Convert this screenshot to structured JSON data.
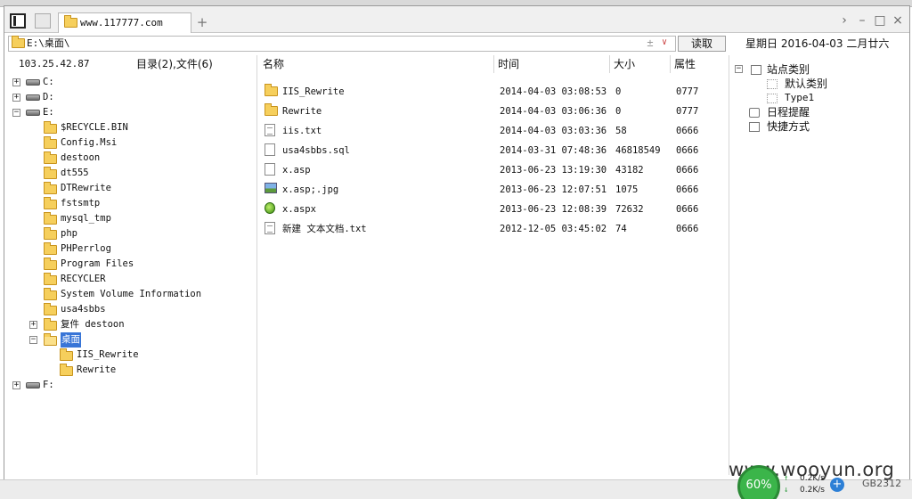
{
  "tab": {
    "title": "www.117777.com",
    "add_label": "+"
  },
  "window_controls": {
    "forward": "›",
    "minimize": "–",
    "maximize": "□",
    "close": "×"
  },
  "address": {
    "path": "E:\\桌面\\",
    "plus": "±",
    "dropdown": "∨",
    "read_label": "读取"
  },
  "date_text": "星期日 2016-04-03 二月廿六",
  "left": {
    "ip": "103.25.42.87",
    "summary": "目录(2),文件(6)",
    "tree": [
      {
        "label": "C:",
        "type": "drive",
        "level": 0,
        "expander": "+"
      },
      {
        "label": "D:",
        "type": "drive",
        "level": 0,
        "expander": "+"
      },
      {
        "label": "E:",
        "type": "drive",
        "level": 0,
        "expander": "−"
      },
      {
        "label": "$RECYCLE.BIN",
        "type": "folder",
        "level": 1
      },
      {
        "label": "Config.Msi",
        "type": "folder",
        "level": 1
      },
      {
        "label": "destoon",
        "type": "folder",
        "level": 1
      },
      {
        "label": "dt555",
        "type": "folder",
        "level": 1
      },
      {
        "label": "DTRewrite",
        "type": "folder",
        "level": 1
      },
      {
        "label": "fstsmtp",
        "type": "folder",
        "level": 1
      },
      {
        "label": "mysql_tmp",
        "type": "folder",
        "level": 1
      },
      {
        "label": "php",
        "type": "folder",
        "level": 1
      },
      {
        "label": "PHPerrlog",
        "type": "folder",
        "level": 1
      },
      {
        "label": "Program Files",
        "type": "folder",
        "level": 1
      },
      {
        "label": "RECYCLER",
        "type": "folder",
        "level": 1
      },
      {
        "label": "System Volume Information",
        "type": "folder",
        "level": 1
      },
      {
        "label": "usa4sbbs",
        "type": "folder",
        "level": 1
      },
      {
        "label": "复件 destoon",
        "type": "folder",
        "level": 1,
        "expander": "+"
      },
      {
        "label": "桌面",
        "type": "folder",
        "level": 1,
        "expander": "−",
        "selected": true
      },
      {
        "label": "IIS_Rewrite",
        "type": "folder",
        "level": 2
      },
      {
        "label": "Rewrite",
        "type": "folder",
        "level": 2
      },
      {
        "label": "F:",
        "type": "drive",
        "level": 0,
        "expander": "+"
      }
    ]
  },
  "files": {
    "headers": {
      "name": "名称",
      "time": "时间",
      "size": "大小",
      "attr": "属性"
    },
    "rows": [
      {
        "name": "IIS_Rewrite",
        "time": "2014-04-03 03:08:53",
        "size": "0",
        "attr": "0777",
        "icon": "folder-icon"
      },
      {
        "name": "Rewrite",
        "time": "2014-04-03 03:06:36",
        "size": "0",
        "attr": "0777",
        "icon": "folder-icon"
      },
      {
        "name": "iis.txt",
        "time": "2014-04-03 03:03:36",
        "size": "58",
        "attr": "0666",
        "icon": "text-file-icon"
      },
      {
        "name": "usa4sbbs.sql",
        "time": "2014-03-31 07:48:36",
        "size": "46818549",
        "attr": "0666",
        "icon": "file-icon"
      },
      {
        "name": "x.asp",
        "time": "2013-06-23 13:19:30",
        "size": "43182",
        "attr": "0666",
        "icon": "script-file-icon"
      },
      {
        "name": "x.asp;.jpg",
        "time": "2013-06-23 12:07:51",
        "size": "1075",
        "attr": "0666",
        "icon": "image-file-icon"
      },
      {
        "name": "x.aspx",
        "time": "2013-06-23 12:08:39",
        "size": "72632",
        "attr": "0666",
        "icon": "aspx-file-icon"
      },
      {
        "name": "新建 文本文档.txt",
        "time": "2012-12-05 03:45:02",
        "size": "74",
        "attr": "0666",
        "icon": "text-file-icon"
      }
    ]
  },
  "right": {
    "site_category": "站点类别",
    "category_items": [
      "默认类别",
      "Type1"
    ],
    "schedule": "日程提醒",
    "shortcuts": "快捷方式",
    "collapse": "−"
  },
  "overlay": {
    "watermark": "www.wooyun.org",
    "percent": "60%",
    "upload": "0.2K/s",
    "download": "0.2K/s",
    "encoding": "GB2312",
    "plus": "+"
  }
}
